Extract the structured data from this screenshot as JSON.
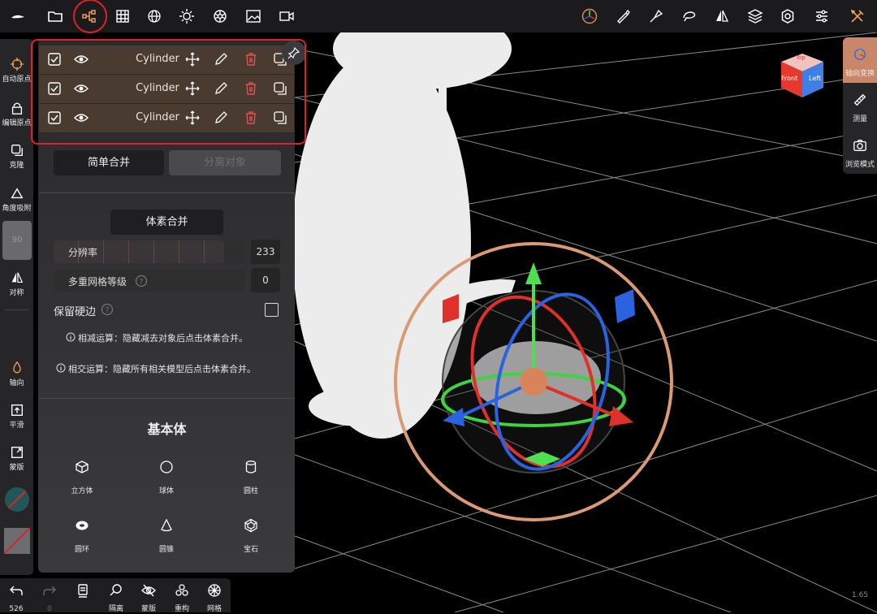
{
  "toolbar": {
    "icons": [
      "app-logo",
      "folder",
      "scene-tree",
      "grid",
      "sphere-mesh",
      "light",
      "material",
      "image",
      "video",
      "axis-gizmo",
      "brush",
      "paint",
      "lasso",
      "symmetry",
      "layers",
      "settings",
      "sliders",
      "tools"
    ]
  },
  "objects": [
    {
      "name": "Cylinder",
      "checked": true
    },
    {
      "name": "Cylinder",
      "checked": true
    },
    {
      "name": "Cylinder",
      "checked": true
    }
  ],
  "merge": {
    "simple_merge": "简单合并",
    "separate": "分离对象",
    "voxel_merge": "体素合并",
    "resolution_label": "分辨率",
    "resolution_value": "233",
    "multires_label": "多重网格等级",
    "multires_value": "0",
    "keep_edges_label": "保留硬边",
    "info_subtract": "相减运算：隐藏减去对象后点击体素合并。",
    "info_intersect": "相交运算：隐藏所有相关模型后点击体素合并。"
  },
  "primitives": {
    "title": "基本体",
    "items": [
      {
        "label": "立方体",
        "icon": "cube-icon"
      },
      {
        "label": "球体",
        "icon": "sphere-icon"
      },
      {
        "label": "圆柱",
        "icon": "cylinder-icon"
      },
      {
        "label": "圆环",
        "icon": "torus-icon"
      },
      {
        "label": "圆锥",
        "icon": "cone-icon"
      },
      {
        "label": "宝石",
        "icon": "gem-icon"
      }
    ]
  },
  "left_tools": {
    "auto_origin": "自动原点",
    "edit_origin": "编辑原点",
    "clone": "克隆",
    "angle_snap": "角度吸附",
    "angle_value": "90",
    "symmetry": "对称",
    "axis": "轴向",
    "smooth": "平滑",
    "mask": "蒙版"
  },
  "right_tools": {
    "axis_transform": "轴向变换",
    "measure": "测量",
    "browse_mode": "浏览模式"
  },
  "view_cube": {
    "top": "Top",
    "front": "Front",
    "left": "Left"
  },
  "bottom": {
    "undo_count": "526",
    "redo_count": "0",
    "isolate": "隔离",
    "mask": "蒙版",
    "remesh": "重构",
    "mesh": "网格"
  },
  "version": "1.65",
  "colors": {
    "highlight": "#e0202a",
    "row_bg": "#4a3b30",
    "gizmo_ring": "#d99a74"
  }
}
